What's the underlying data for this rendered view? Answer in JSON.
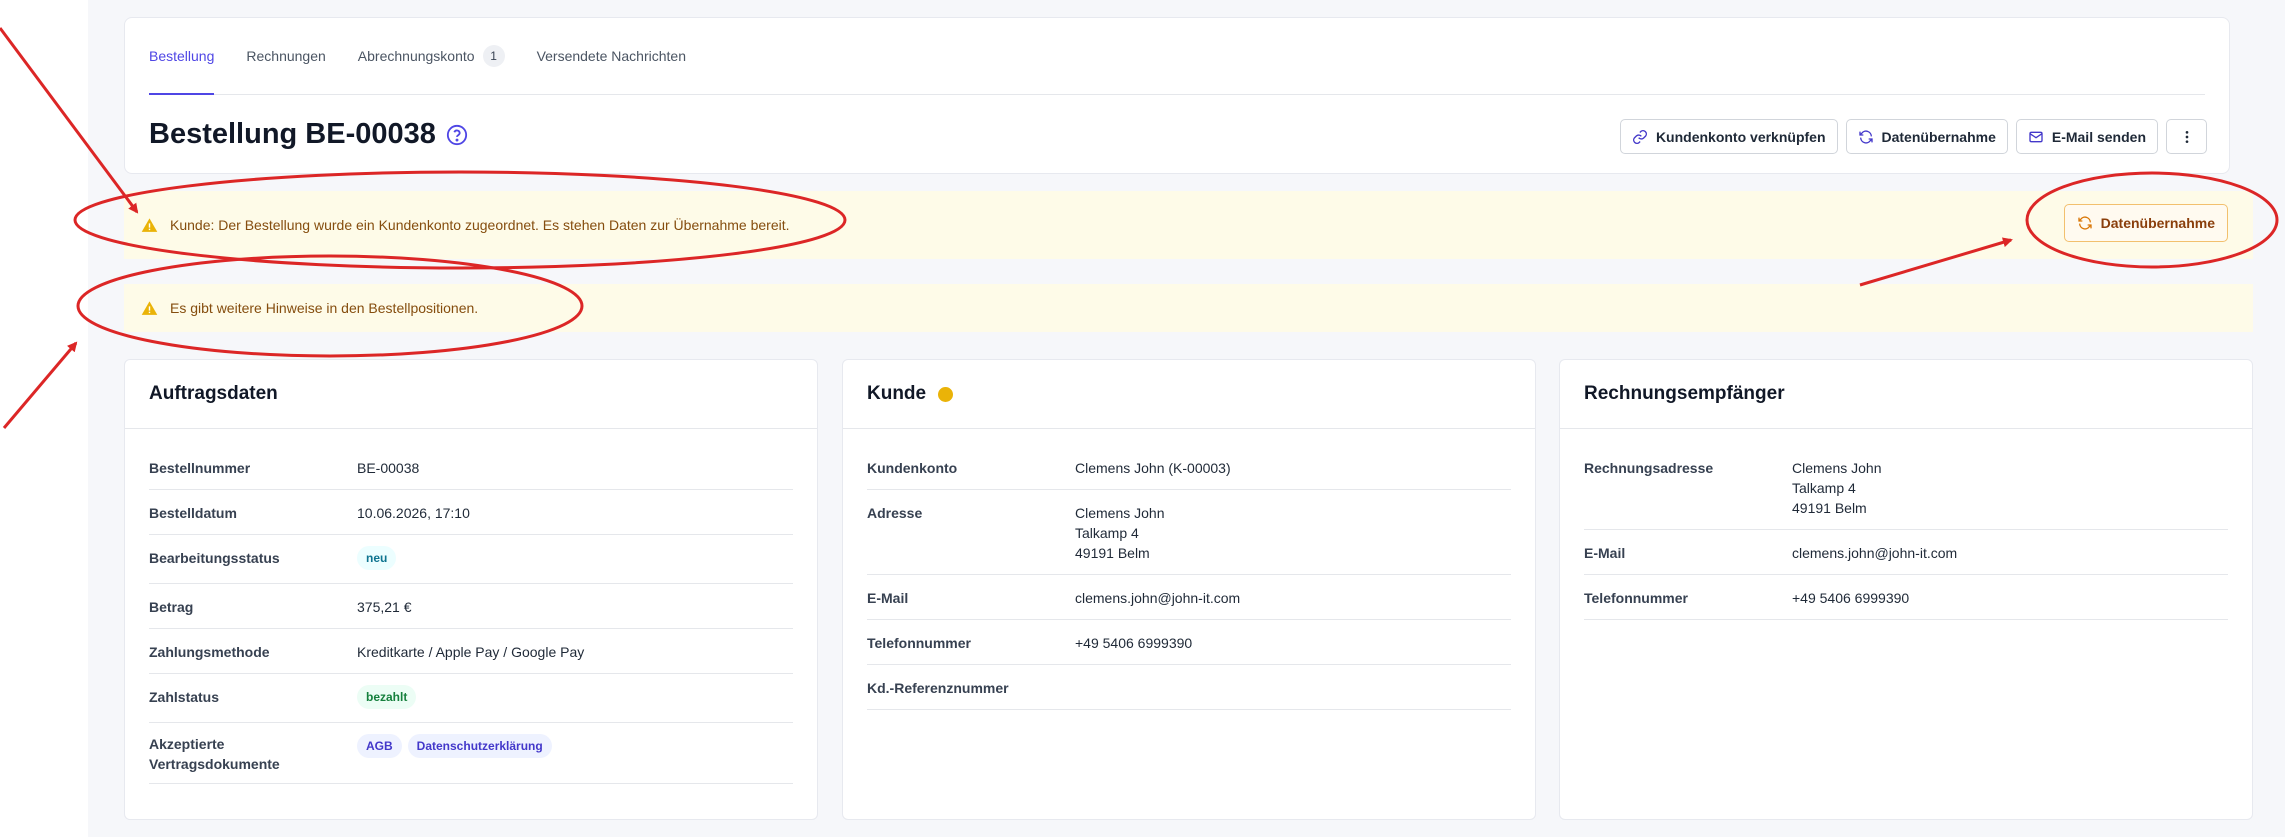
{
  "tabs": [
    {
      "label": "Bestellung",
      "active": true
    },
    {
      "label": "Rechnungen",
      "active": false
    },
    {
      "label": "Abrechnungskonto",
      "badge": "1",
      "active": false
    },
    {
      "label": "Versendete Nachrichten",
      "active": false
    }
  ],
  "page": {
    "title": "Bestellung BE-00038",
    "help_icon": "question-circle-icon"
  },
  "actions": {
    "link_account": "Kundenkonto verknüpfen",
    "data_transfer": "Datenübernahme",
    "send_email": "E-Mail senden",
    "more": "more-vertical-icon"
  },
  "alerts": {
    "customer": "Kunde: Der Bestellung wurde ein Kundenkonto zugeordnet. Es stehen Daten zur Übernahme bereit.",
    "customer_button": "Datenübernahme",
    "positions": "Es gibt weitere Hinweise in den Bestellpositionen."
  },
  "order_card": {
    "title": "Auftragsdaten",
    "order_number_label": "Bestellnummer",
    "order_number": "BE-00038",
    "order_date_label": "Bestelldatum",
    "order_date": "10.06.2026, 17:10",
    "status_label": "Bearbeitungsstatus",
    "status": "neu",
    "amount_label": "Betrag",
    "amount": "375,21 €",
    "payment_method_label": "Zahlungsmethode",
    "payment_method": "Kreditkarte / Apple Pay / Google Pay",
    "payment_status_label": "Zahlstatus",
    "payment_status": "bezahlt",
    "documents_label_1": "Akzeptierte",
    "documents_label_2": "Vertragsdokumente",
    "documents": [
      "AGB",
      "Datenschutzerklärung"
    ]
  },
  "customer_card": {
    "title": "Kunde",
    "account_label": "Kundenkonto",
    "account": "Clemens John (K-00003)",
    "address_label": "Adresse",
    "address": [
      "Clemens John",
      "Talkamp 4",
      "49191 Belm"
    ],
    "email_label": "E-Mail",
    "email": "clemens.john@john-it.com",
    "phone_label": "Telefonnummer",
    "phone": "+49 5406 6999390",
    "ref_label": "Kd.-Referenznummer",
    "ref": ""
  },
  "billing_card": {
    "title": "Rechnungsempfänger",
    "address_label": "Rechnungsadresse",
    "address": [
      "Clemens John",
      "Talkamp 4",
      "49191 Belm"
    ],
    "email_label": "E-Mail",
    "email": "clemens.john@john-it.com",
    "phone_label": "Telefonnummer",
    "phone": "+49 5406 6999390"
  },
  "colors": {
    "accent": "#4f46e5",
    "warning_bg": "#fefbe8",
    "warning_icon": "#eab308",
    "annotation": "#dc2626"
  }
}
